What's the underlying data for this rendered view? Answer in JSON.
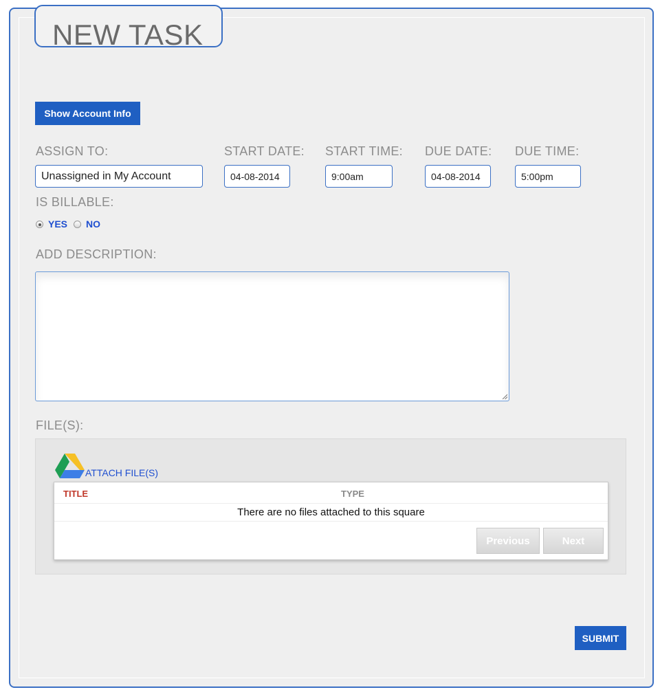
{
  "header": {
    "title": "NEW TASK"
  },
  "account_button": {
    "label": "Show Account Info"
  },
  "fields": {
    "assign_to": {
      "label": "ASSIGN TO:",
      "value": "Unassigned in My Account"
    },
    "start_date": {
      "label": "START DATE:",
      "value": "04-08-2014"
    },
    "start_time": {
      "label": "START TIME:",
      "value": "9:00am"
    },
    "due_date": {
      "label": "DUE DATE:",
      "value": "04-08-2014"
    },
    "due_time": {
      "label": "DUE TIME:",
      "value": "5:00pm"
    }
  },
  "billable": {
    "label": "IS BILLABLE:",
    "yes": "YES",
    "no": "NO",
    "selected": "YES"
  },
  "description": {
    "label": "ADD DESCRIPTION:",
    "value": ""
  },
  "files": {
    "label": "FILE(S):",
    "attach_label": "ATTACH FILE(S)",
    "columns": [
      "TITLE",
      "TYPE"
    ],
    "empty_message": "There are no files attached to this square",
    "previous": "Previous",
    "next": "Next"
  },
  "submit": {
    "label": "SUBMIT"
  },
  "colors": {
    "accent": "#1f5fc2",
    "border": "#3a6fc4",
    "link": "#1f4fd0",
    "title_col": "#c0392b"
  },
  "icons": {
    "drive": "google-drive-icon"
  }
}
